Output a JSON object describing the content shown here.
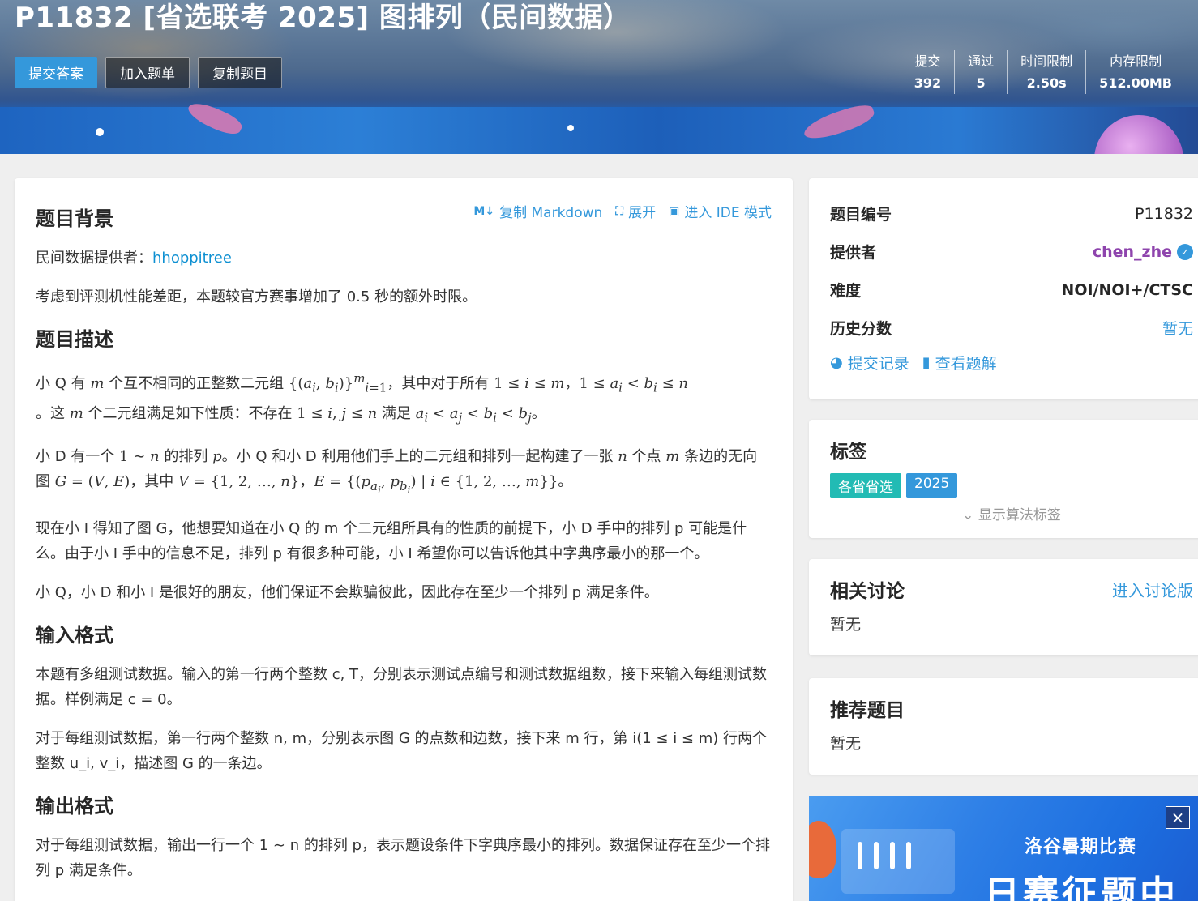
{
  "header": {
    "title": "P11832 [省选联考 2025] 图排列（民间数据）",
    "actions": {
      "submit": "提交答案",
      "add_to_list": "加入题单",
      "copy_problem": "复制题目"
    },
    "stats": [
      {
        "label": "提交",
        "value": "392"
      },
      {
        "label": "通过",
        "value": "5"
      },
      {
        "label": "时间限制",
        "value": "2.50s"
      },
      {
        "label": "内存限制",
        "value": "512.00MB"
      }
    ]
  },
  "toolbar": {
    "copy_markdown": "复制 Markdown",
    "expand": "展开",
    "ide": "进入 IDE 模式"
  },
  "content": {
    "background_title": "题目背景",
    "provider_prefix": "民间数据提供者：",
    "provider_name": "hhoppitree",
    "extra_time": "考虑到评测机性能差距，本题较官方赛事增加了 0.5 秒的额外时限。",
    "desc_title": "题目描述",
    "desc_p1_a": "小 Q 有 ",
    "desc_p1_b": " 个互不相同的正整数二元组 ",
    "desc_p1_c": "，其中对于所有 ",
    "desc_p1_d": "。这 ",
    "desc_p1_e": " 个二元组满足如下性质：不存在 ",
    "desc_p1_f": " 满足 ",
    "desc_p2_a": "小 D 有一个 ",
    "desc_p2_b": " 的排列 ",
    "desc_p2_c": "。小 Q 和小 D 利用他们手上的二元组和排列一起构建了一张 ",
    "desc_p2_d": " 个点 ",
    "desc_p2_e": " 条边的无向图 ",
    "desc_p2_f": "，其中 ",
    "desc_p3": "现在小 I 得知了图 G，他想要知道在小 Q 的 m 个二元组所具有的性质的前提下，小 D 手中的排列 p 可能是什么。由于小 I 手中的信息不足，排列 p 有很多种可能，小 I 希望你可以告诉他其中字典序最小的那一个。",
    "desc_p4": "小 Q，小 D 和小 I 是很好的朋友，他们保证不会欺骗彼此，因此存在至少一个排列 p 满足条件。",
    "input_title": "输入格式",
    "input_p1": "本题有多组测试数据。输入的第一行两个整数 c, T，分别表示测试点编号和测试数据组数，接下来输入每组测试数据。样例满足 c = 0。",
    "input_p2": "对于每组测试数据，第一行两个整数 n, m，分别表示图 G 的点数和边数，接下来 m 行，第 i(1 ≤ i ≤ m) 行两个整数 u_i, v_i，描述图 G 的一条边。",
    "output_title": "输出格式",
    "output_p1": "对于每组测试数据，输出一行一个 1 ∼ n 的排列 p，表示题设条件下字典序最小的排列。数据保证存在至少一个排列 p 满足条件。"
  },
  "info": {
    "rows": [
      {
        "key": "题目编号",
        "value": "P11832"
      },
      {
        "key": "提供者",
        "value": "chen_zhe"
      },
      {
        "key": "难度",
        "value": "NOI/NOI+/CTSC"
      },
      {
        "key": "历史分数",
        "value": "暂无"
      }
    ],
    "submit_records": "提交记录",
    "view_solutions": "查看题解"
  },
  "tags": {
    "title": "标签",
    "items": [
      "各省省选",
      "2025"
    ],
    "show_algo": "显示算法标签"
  },
  "discussion": {
    "title": "相关讨论",
    "enter": "进入讨论版",
    "empty": "暂无"
  },
  "recommend": {
    "title": "推荐题目",
    "empty": "暂无"
  },
  "ad": {
    "line1": "洛谷暑期比赛",
    "line2": "日赛征题中",
    "close": "×"
  }
}
